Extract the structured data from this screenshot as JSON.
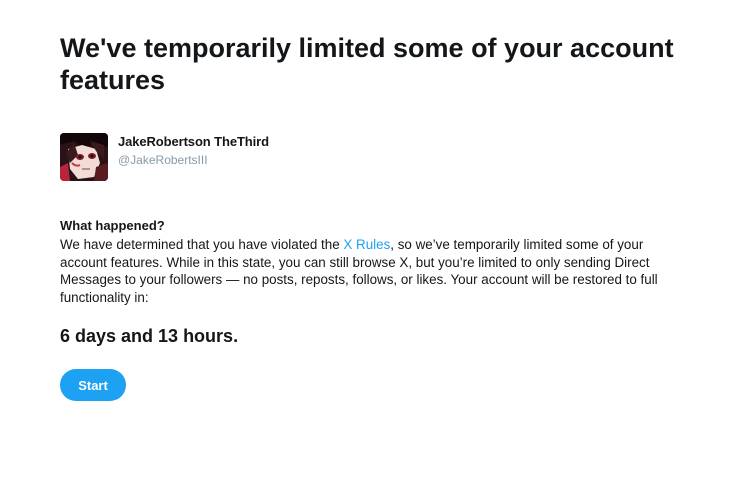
{
  "header": {
    "title": "We've temporarily limited some of your account features"
  },
  "account": {
    "display_name": "JakeRobertson TheThird",
    "handle": "@JakeRobertsIII",
    "avatar_icon": "anime-character-avatar"
  },
  "notice": {
    "heading": "What happened?",
    "text_before_link": "We have determined that you have violated the ",
    "link_text": "X Rules",
    "text_after_link": ", so we’ve temporarily limited some of your account features. While in this state, you can still browse X, but you’re limited to only sending Direct Messages to your followers — no posts, reposts, follows, or likes. Your account will be restored to full functionality in:"
  },
  "countdown": {
    "text": "6 days and 13 hours."
  },
  "actions": {
    "start_label": "Start"
  },
  "colors": {
    "accent": "#1da1f2",
    "text": "#14171a",
    "secondary_text": "#8899a6"
  }
}
